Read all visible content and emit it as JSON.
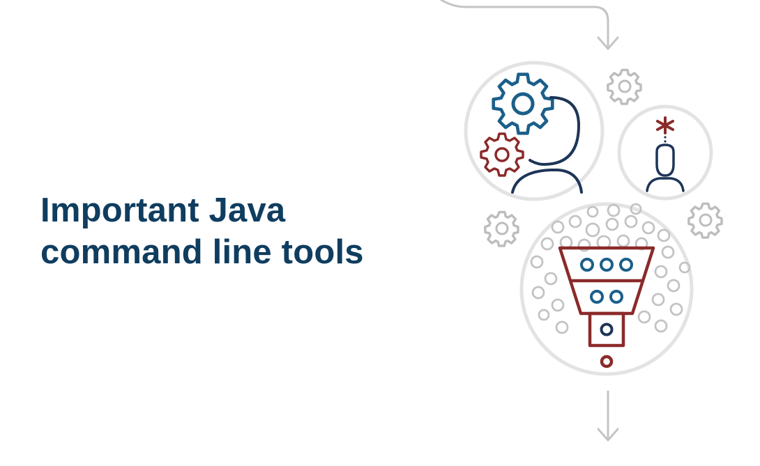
{
  "slide": {
    "title_lines": [
      "Important Java",
      "command line tools"
    ]
  },
  "illustration": {
    "icons": [
      "flow-arrow-icon",
      "person-gears-icon",
      "person-idea-icon",
      "gear-icon",
      "filter-funnel-icon"
    ],
    "colors": {
      "title": "#0f3d5f",
      "blue": "#1b5f8a",
      "red": "#8b2a2a",
      "navy": "#1d3557",
      "gray": "#b8b8b8",
      "light_gray": "#e3e3e3"
    }
  }
}
